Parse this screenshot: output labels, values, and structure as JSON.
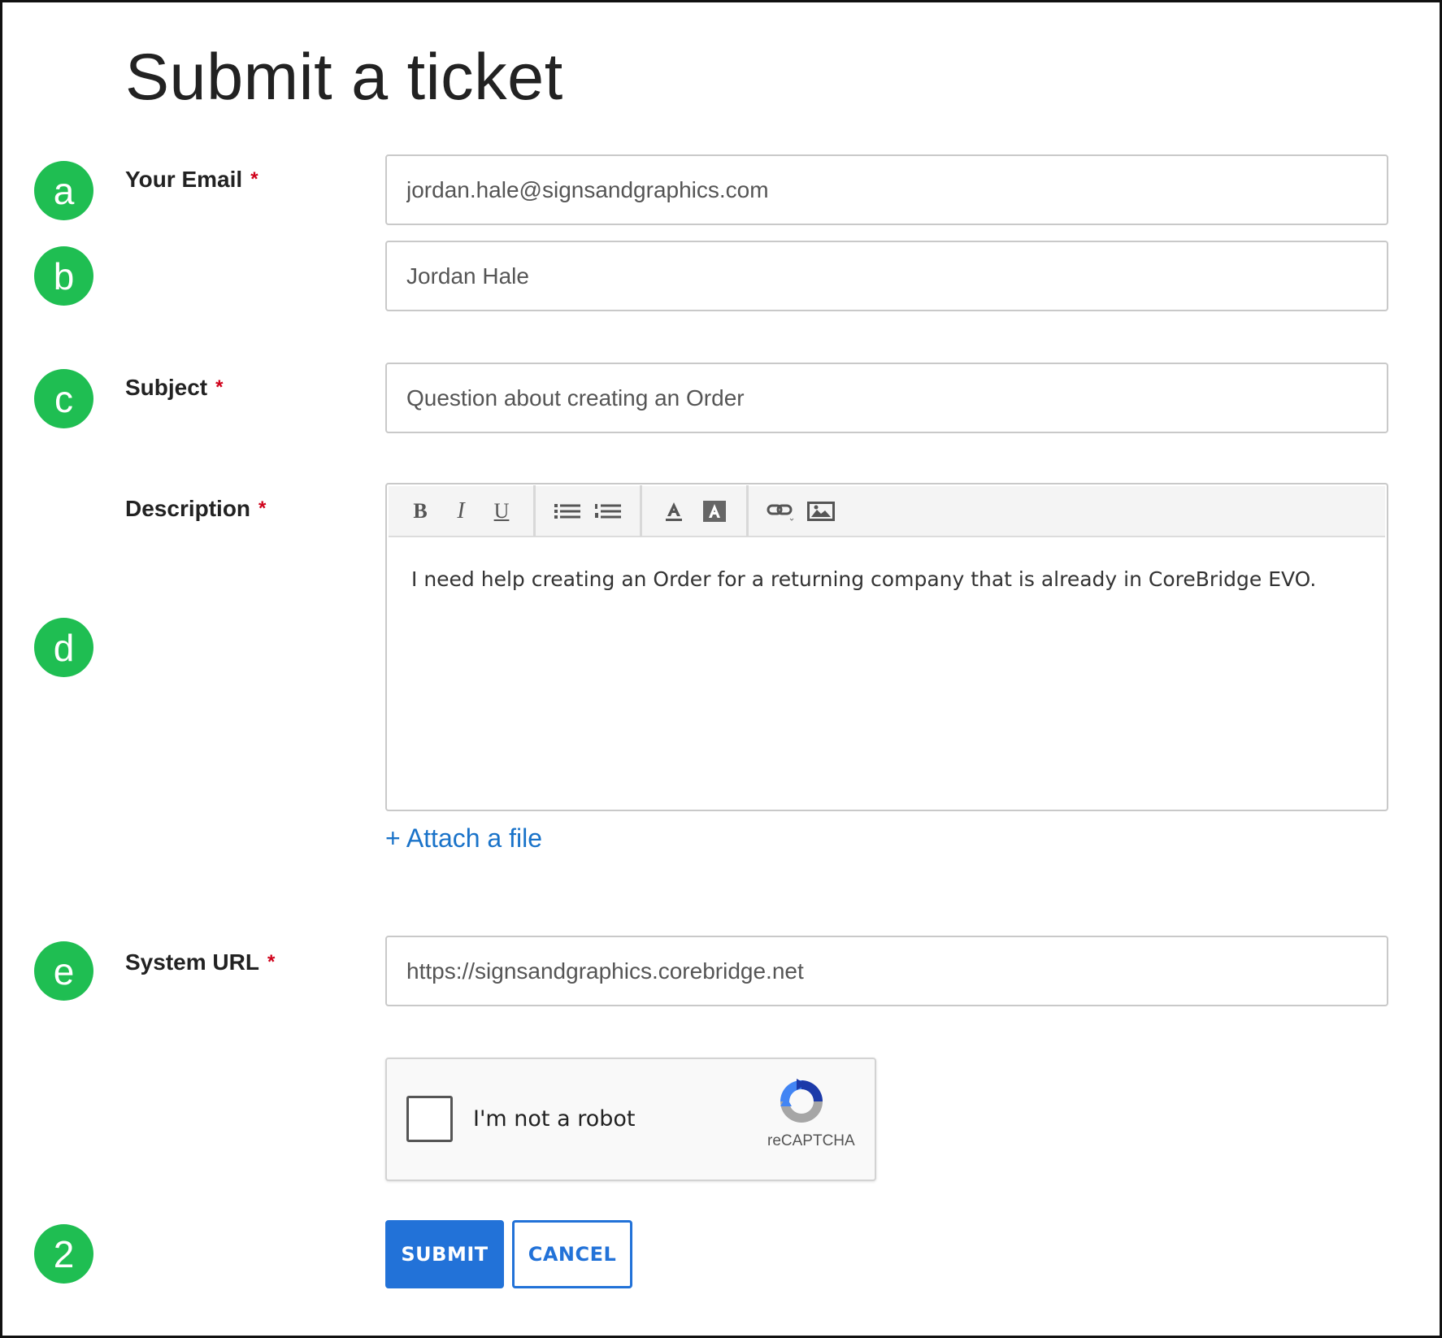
{
  "page": {
    "title": "Submit a ticket"
  },
  "markers": {
    "a": "a",
    "b": "b",
    "c": "c",
    "d": "d",
    "e": "e",
    "two": "2"
  },
  "form": {
    "required_mark": "*",
    "email": {
      "label": "Your Email",
      "value": "jordan.hale@signsandgraphics.com"
    },
    "name": {
      "value": "Jordan Hale"
    },
    "subject": {
      "label": "Subject",
      "value": "Question about creating an Order"
    },
    "description": {
      "label": "Description",
      "value": "I need help creating an Order for a returning company that is already in CoreBridge EVO.",
      "toolbar": {
        "bold": "B",
        "italic": "I",
        "underline": "U"
      }
    },
    "attach_label": "+ Attach a file",
    "system_url": {
      "label": "System URL",
      "value": "https://signsandgraphics.corebridge.net"
    }
  },
  "captcha": {
    "text": "I'm not a robot",
    "brand": "reCAPTCHA"
  },
  "buttons": {
    "submit": "SUBMIT",
    "cancel": "CANCEL"
  },
  "colors": {
    "marker": "#1fbe52",
    "primary": "#2272d8",
    "link": "#1a73c9",
    "required": "#d0021b"
  }
}
